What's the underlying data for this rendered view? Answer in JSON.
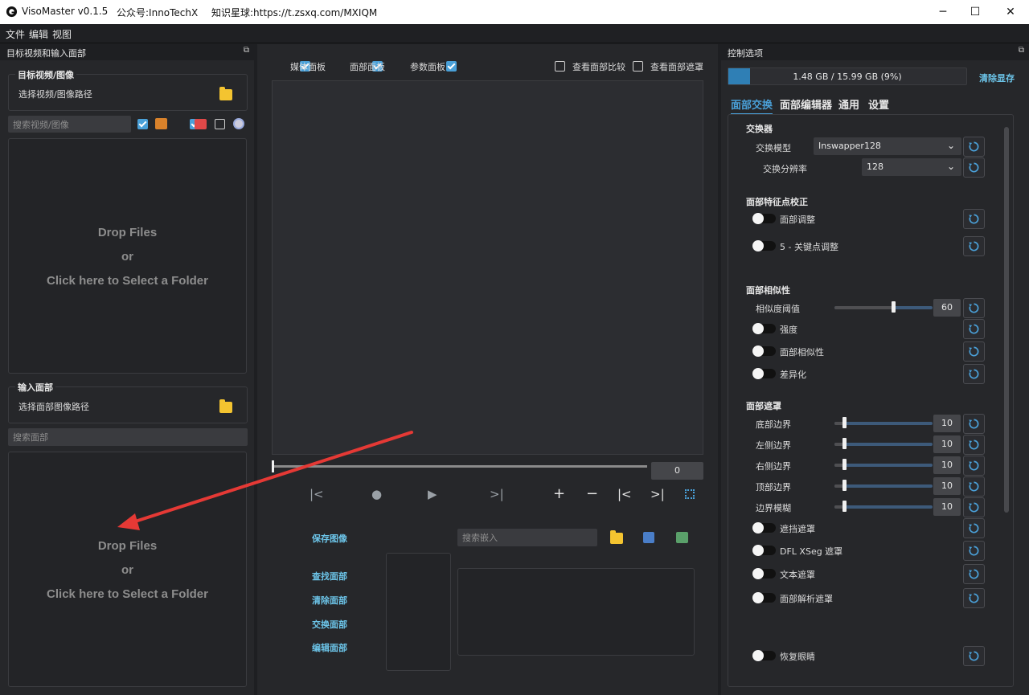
{
  "window": {
    "app_title": "VisoMaster v0.1.5",
    "wechat": "公众号:InnoTechX",
    "planet": "知识星球:https://t.zsxq.com/MXIQM",
    "minimize": "─",
    "maximize": "☐",
    "close": "✕"
  },
  "menu": {
    "file": "文件",
    "edit": "编辑",
    "view": "视图"
  },
  "left": {
    "dock_title": "目标视频和输入面部",
    "target_group": "目标视频/图像",
    "target_path_label": "选择视频/图像路径",
    "search_media_placeholder": "搜索视频/图像",
    "drop": {
      "line1": "Drop Files",
      "line2": "or",
      "line3": "Click here to Select a Folder"
    },
    "input_group": "输入面部",
    "face_path_label": "选择面部图像路径",
    "search_face_placeholder": "搜索面部",
    "filters": {
      "images_checked": true,
      "videos_checked": true,
      "webcam_checked": false
    }
  },
  "center": {
    "cb_media": "媒体面板",
    "cb_faces": "面部面板",
    "cb_params": "参数面板",
    "cb_compare": "查看面部比较",
    "cb_mask": "查看面部遮罩",
    "frame_number": "0",
    "save_image": "保存图像",
    "search_embed_placeholder": "搜索嵌入",
    "find_faces": "查找面部",
    "clear_faces": "清除面部",
    "swap_faces": "交换面部",
    "edit_faces": "编辑面部",
    "controls": {
      "prev": "|<",
      "record": "●",
      "play": "▶",
      "next": ">|",
      "add": "+",
      "remove": "−",
      "prev_marker": "|<",
      "next_marker": ">|"
    }
  },
  "right": {
    "dock_title": "控制选项",
    "vram_text": "1.48 GB / 15.99 GB (9%)",
    "vram_fraction": 0.09,
    "clear_vram": "清除显存",
    "tabs": [
      "面部交换",
      "面部编辑器",
      "通用",
      "设置"
    ],
    "swapper": {
      "title": "交换器",
      "model_label": "交换模型",
      "model_value": "Inswapper128",
      "resolution_label": "交换分辨率",
      "resolution_value": "128"
    },
    "landmark": {
      "title": "面部特征点校正",
      "face_adjust": "面部调整",
      "kps_adjust": "5 - 关键点调整"
    },
    "similarity": {
      "title": "面部相似性",
      "threshold_label": "相似度阈值",
      "threshold_value": "60",
      "threshold_fraction": 0.6,
      "strength": "强度",
      "face_similarity": "面部相似性",
      "differencing": "差异化"
    },
    "mask": {
      "title": "面部遮罩",
      "bottom_border": "底部边界",
      "bottom_value": "10",
      "left_border": "左侧边界",
      "left_value": "10",
      "right_border": "右侧边界",
      "right_value": "10",
      "top_border": "顶部边界",
      "top_value": "10",
      "border_blur": "边界模糊",
      "blur_value": "10",
      "slider_fraction": 0.1,
      "occlusion": "遮挡遮罩",
      "xseg": "DFL XSeg 遮罩",
      "text_mask": "文本遮罩",
      "parser_mask": "面部解析遮罩",
      "restore_eyes": "恢复眼睛"
    }
  },
  "colors": {
    "accent": "#4aa0d8",
    "bg": "#1e1f22",
    "panel": "#26272a",
    "arrow": "#e53935"
  }
}
